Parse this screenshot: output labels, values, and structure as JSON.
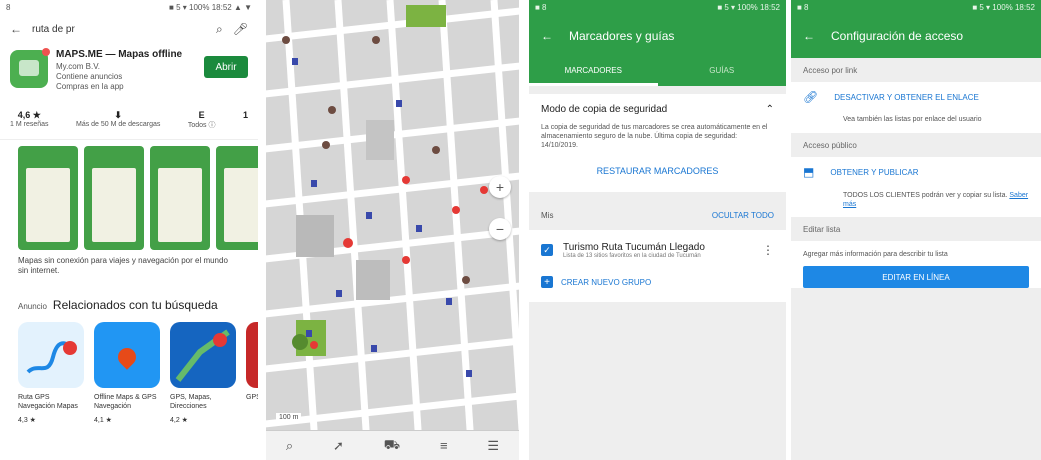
{
  "colors": {
    "green": "#2e9e48",
    "blue": "#1e88e5",
    "map_bg": "#d9d9d9"
  },
  "panel1": {
    "status": {
      "left": "8",
      "right": "■ 5 ▾ 100% 18:52 ▲ ▼"
    },
    "search": {
      "query": "ruta de pr"
    },
    "app": {
      "name": "MAPS.ME — Mapas offline",
      "dev": "My.com B.V.",
      "line2": "Contiene anuncios",
      "line3": "Compras en la app",
      "open_label": "Abrir"
    },
    "stats": [
      {
        "value": "4,6 ★",
        "label": "1 M reseñas"
      },
      {
        "value": "⬇",
        "label": "Más de 50 M de descargas"
      },
      {
        "value": "E",
        "label": "Todos ⓘ"
      },
      {
        "value": "1",
        "label": ""
      }
    ],
    "description": "Mapas sin conexión para viajes y navegación por el mundo sin internet.",
    "related": {
      "ad": "Anuncio",
      "title": "Relacionados con tu búsqueda"
    },
    "related_apps": [
      {
        "name": "Ruta GPS Navegación Mapas",
        "rating": "4,3 ★"
      },
      {
        "name": "Offline Maps & GPS Navegación",
        "rating": "4,1 ★"
      },
      {
        "name": "GPS, Mapas, Direcciones",
        "rating": "4,2 ★"
      },
      {
        "name": "GPS",
        "rating": ""
      }
    ]
  },
  "panel2": {
    "scale": "100 m",
    "zoom_in": "+",
    "zoom_out": "−",
    "bottom": [
      "⌕",
      "➚",
      "⛟",
      "≡",
      "☰"
    ]
  },
  "panel3": {
    "status": {
      "left": "■ 8",
      "right": "■ 5 ▾ 100% 18:52"
    },
    "title": "Marcadores y guías",
    "tabs": [
      "MARCADORES",
      "GUÍAS"
    ],
    "backup": {
      "title": "Modo de copia de seguridad",
      "text": "La copia de seguridad de tus marcadores se crea automáticamente en el almacenamiento seguro de la nube. Última copia de seguridad: 14/10/2019.",
      "action": "RESTAURAR MARCADORES"
    },
    "section": {
      "label": "Mis",
      "action": "OCULTAR TODO"
    },
    "track": {
      "name": "Turismo Ruta Tucumán Llegado",
      "sub": "Lista de 13 sitios favoritos en la ciudad de Tucumán"
    },
    "new_folder": "CREAR NUEVO GRUPO"
  },
  "panel4": {
    "status": {
      "left": "■ 8",
      "right": "■ 5 ▾ 100% 18:52"
    },
    "title": "Configuración de acceso",
    "group1": "Acceso por link",
    "link_row": "DESACTIVAR Y OBTENER EL ENLACE",
    "link_sub": "Vea también las listas por enlace del usuario",
    "group2": "Acceso público",
    "public_row": "OBTENER Y PUBLICAR",
    "public_sub": "TODOS LOS CLIENTES podrán ver y copiar su lista.",
    "public_link": "Saber más",
    "group3": "Editar lista",
    "info": "Agregar más información para describir tu lista",
    "button": "EDITAR EN LÍNEA"
  }
}
